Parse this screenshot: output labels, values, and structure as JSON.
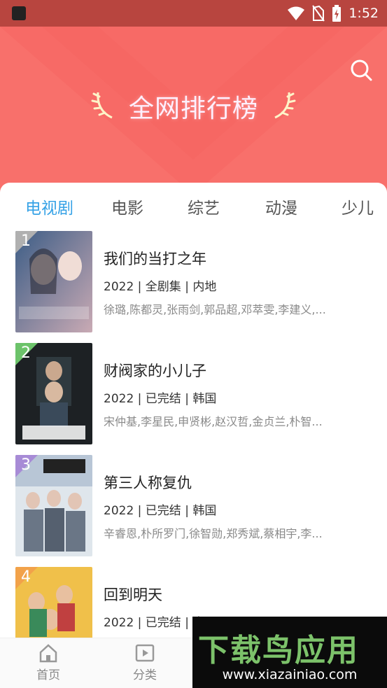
{
  "status_bar": {
    "time": "1:52",
    "icons": [
      "app-icon",
      "wifi-icon",
      "no-sim-icon",
      "battery-charging-icon"
    ]
  },
  "header": {
    "title": "全网排行榜",
    "search_icon": "search-icon",
    "colors": {
      "background": "#f76a66",
      "status_bar": "#b8453f"
    }
  },
  "tabs": [
    {
      "label": "电视剧",
      "active": true
    },
    {
      "label": "电影",
      "active": false
    },
    {
      "label": "综艺",
      "active": false
    },
    {
      "label": "动漫",
      "active": false
    },
    {
      "label": "少儿",
      "active": false
    }
  ],
  "accent_color": "#36a2e6",
  "rankings": [
    {
      "rank": "1",
      "title": "我们的当打之年",
      "meta": "2022 | 全剧集 | 内地",
      "cast": "徐璐,陈都灵,张雨剑,郭品超,邓萃雯,李建义,...",
      "rank_color": "#b0b0b0"
    },
    {
      "rank": "2",
      "title": "财阀家的小儿子",
      "meta": "2022 | 已完结 | 韩国",
      "cast": "宋仲基,李星民,申贤彬,赵汉哲,金贞兰,朴智...",
      "rank_color": "#6cc36a"
    },
    {
      "rank": "3",
      "title": "第三人称复仇",
      "meta": "2022 | 已完结 | 韩国",
      "cast": "辛睿恩,朴所罗门,徐智勋,郑秀斌,蔡相宇,李...",
      "rank_color": "#a78bd6"
    },
    {
      "rank": "4",
      "title": "回到明天",
      "meta": "2022 | 已完结 | 内国",
      "cast": "",
      "rank_color": "#f2a24a"
    }
  ],
  "bottom_nav": [
    {
      "label": "首页",
      "icon": "home-icon"
    },
    {
      "label": "分类",
      "icon": "category-icon"
    }
  ],
  "watermark": {
    "logo_text": "下载鸟应用",
    "url": "www.xiazainiao.com"
  }
}
